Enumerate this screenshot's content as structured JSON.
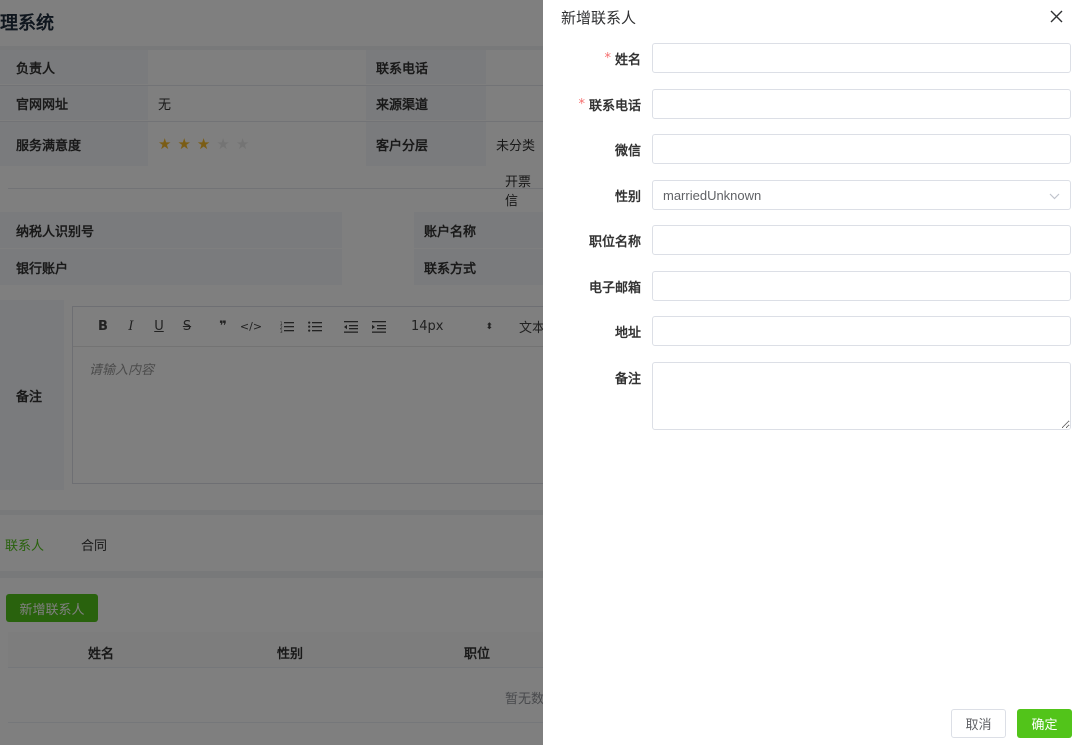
{
  "background": {
    "app_title": "理系统",
    "info": {
      "owner_label": "负责人",
      "owner_value": "",
      "phone_label": "联系电话",
      "website_label": "官网网址",
      "website_value": "无",
      "source_label": "来源渠道",
      "satisfaction_label": "服务满意度",
      "satisfaction_rating": 3,
      "satisfaction_max": 5,
      "tier_label": "客户分层",
      "tier_value": "未分类",
      "invoice_label": "开票信",
      "taxid_label": "纳税人识别号",
      "account_name_label": "账户名称",
      "bank_label": "银行账户",
      "contact_method_label": "联系方式",
      "remark_label": "备注"
    },
    "editor": {
      "font_size": "14px",
      "text_label": "文本",
      "placeholder": "请输入内容"
    },
    "tabs": [
      {
        "label": "联系人",
        "active": true
      },
      {
        "label": "合同",
        "active": false
      }
    ],
    "add_contact_button": "新增联系人",
    "table_headers": [
      "姓名",
      "性别",
      "职位"
    ],
    "empty_text": "暂无数"
  },
  "drawer": {
    "title": "新增联系人",
    "fields": {
      "name": {
        "label": "姓名",
        "required": true,
        "value": ""
      },
      "phone": {
        "label": "联系电话",
        "required": true,
        "value": ""
      },
      "wechat": {
        "label": "微信",
        "value": ""
      },
      "gender": {
        "label": "性别",
        "value": "marriedUnknown"
      },
      "position": {
        "label": "职位名称",
        "value": ""
      },
      "email": {
        "label": "电子邮箱",
        "value": ""
      },
      "address": {
        "label": "地址",
        "value": ""
      },
      "remark": {
        "label": "备注",
        "value": ""
      }
    },
    "cancel_label": "取消",
    "confirm_label": "确定"
  },
  "colors": {
    "primary": "#52c41a",
    "required": "#f56c6c",
    "star_on": "#f7ba2a",
    "star_off": "#e9e9e9"
  }
}
